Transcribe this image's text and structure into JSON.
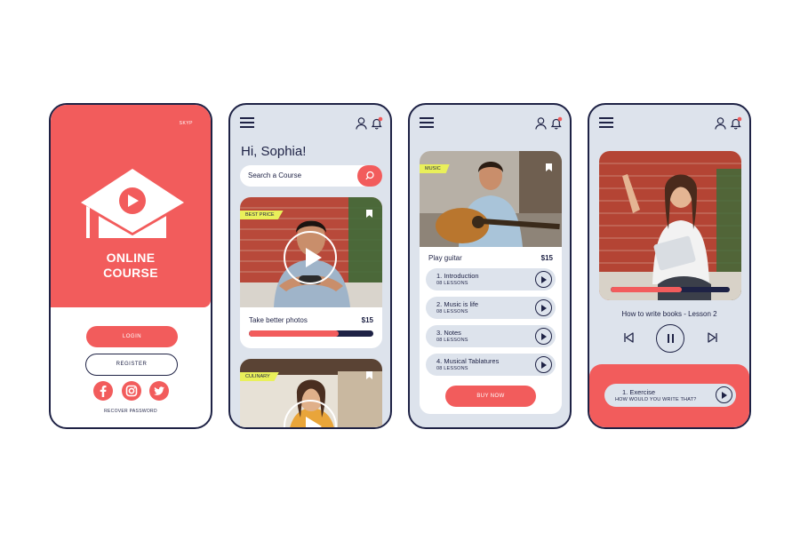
{
  "colors": {
    "accent": "#f25c5c",
    "navy": "#1e2245",
    "panel": "#dde3ec",
    "tag": "#e9f05a"
  },
  "welcome": {
    "skip": "SKYP",
    "brand_line1": "ONLINE",
    "brand_line2": "COURSE",
    "login": "LOGIN",
    "register": "REGISTER",
    "social": [
      "facebook-icon",
      "instagram-icon",
      "twitter-icon"
    ],
    "recover": "RECOVER PASSWORD"
  },
  "home": {
    "greeting": "Hi, Sophia!",
    "search_placeholder": "Search a Course",
    "course1": {
      "tag": "BEST PRICE",
      "title": "Take better photos",
      "price": "$15",
      "progress": 0.72
    },
    "course2": {
      "tag": "CULINARY"
    }
  },
  "course": {
    "tag": "MUSIC",
    "title": "Play guitar",
    "price": "$15",
    "lessons": [
      {
        "title": "1. Introduction",
        "sub": "08 LESSONS"
      },
      {
        "title": "2. Music is life",
        "sub": "08 LESSONS"
      },
      {
        "title": "3. Notes",
        "sub": "08 LESSONS"
      },
      {
        "title": "4. Musical Tablatures",
        "sub": "08 LESSONS"
      }
    ],
    "buy": "BUY NOW"
  },
  "player": {
    "lesson_title": "How to write books - Lesson 2",
    "progress": 0.6,
    "exercise_title": "1. Exercise",
    "exercise_sub": "HOW WOULD YOU WRITE THAT?"
  }
}
